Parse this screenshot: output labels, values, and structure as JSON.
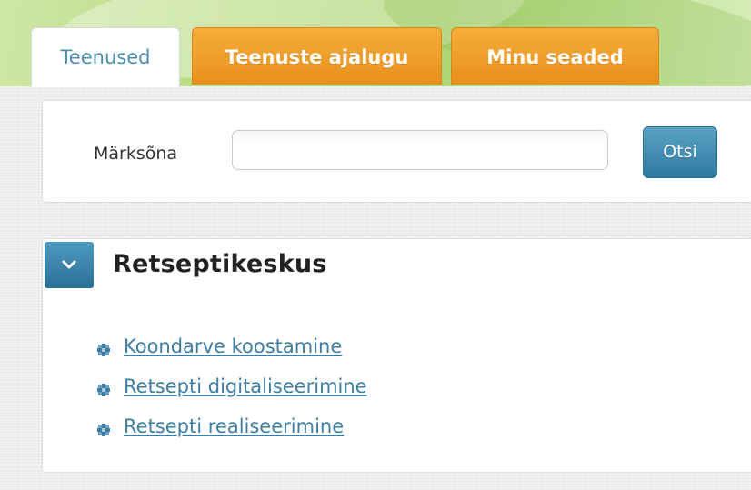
{
  "tabs": [
    {
      "label": "Teenused",
      "active": true
    },
    {
      "label": "Teenuste ajalugu",
      "active": false
    },
    {
      "label": "Minu seaded",
      "active": false
    }
  ],
  "search": {
    "label": "Märksõna",
    "value": "",
    "placeholder": "",
    "button_label": "Otsi"
  },
  "section": {
    "title": "Retseptikeskus",
    "toggle_icon": "chevron-down-icon",
    "items": [
      {
        "label": "Koondarve koostamine",
        "icon": "bullet-icon"
      },
      {
        "label": "Retsepti digitaliseerimine",
        "icon": "bullet-icon"
      },
      {
        "label": "Retsepti realiseerimine",
        "icon": "bullet-icon"
      }
    ]
  },
  "colors": {
    "active_tab_text": "#4c8fb0",
    "orange_tab": "#f0a02a",
    "button_blue": "#3d88ae",
    "link_blue": "#3d7ea2"
  }
}
